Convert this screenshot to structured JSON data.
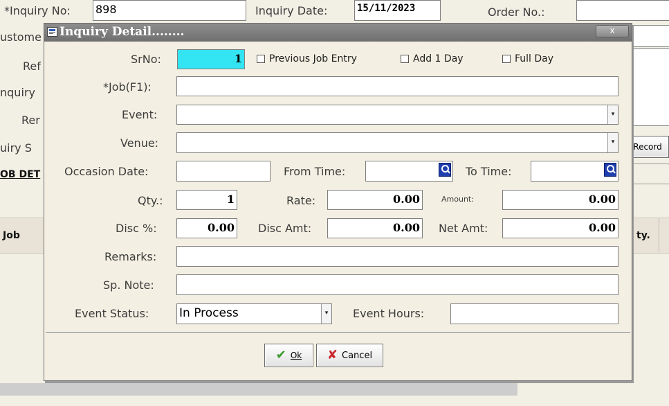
{
  "background": {
    "inquiry_no_label": "*Inquiry No:",
    "inquiry_no_value": "898",
    "inquiry_date_label": "Inquiry  Date:",
    "inquiry_date_value": "15/11/2023",
    "order_no_label": "Order No.:",
    "left_labels": [
      "ustome",
      "Ref",
      "nquiry",
      "Rer",
      "uiry S",
      "OB DET"
    ],
    "record_button": "Record",
    "grid_left_header": "Job",
    "grid_right_header": "ty."
  },
  "dialog": {
    "title": "Inquiry Detail........",
    "close_glyph": "x",
    "srno_label": "SrNo:",
    "srno_value": "1",
    "checkbox_previous": "Previous Job Entry",
    "checkbox_add_day": "Add 1  Day",
    "checkbox_full_day": "Full Day",
    "job_label": "*Job(F1):",
    "job_value": "",
    "event_label": "Event:",
    "event_value": "",
    "venue_label": "Venue:",
    "venue_value": "",
    "occasion_date_label": "Occasion Date:",
    "occasion_date_value": "",
    "from_time_label": "From Time:",
    "to_time_label": "To Time:",
    "qty_label": "Qty.:",
    "qty_value": "1",
    "rate_label": "Rate:",
    "rate_value": "0.00",
    "amount_label": "Amount:",
    "amount_value": "0.00",
    "disc_pct_label": "Disc %:",
    "disc_pct_value": "0.00",
    "disc_amt_label": "Disc Amt:",
    "disc_amt_value": "0.00",
    "net_amt_label": "Net Amt:",
    "net_amt_value": "0.00",
    "remarks_label": "Remarks:",
    "sp_note_label": "Sp. Note:",
    "event_status_label": "Event Status:",
    "event_status_value": "In Process",
    "event_hours_label": "Event Hours:",
    "ok_button": "Ok",
    "cancel_button": "Cancel"
  },
  "colors": {
    "dialog_title_bar": "#7b7b7b",
    "srno_highlight": "#33e4f2",
    "ok_check": "#3c9a2e",
    "cancel_x": "#c8252c"
  }
}
